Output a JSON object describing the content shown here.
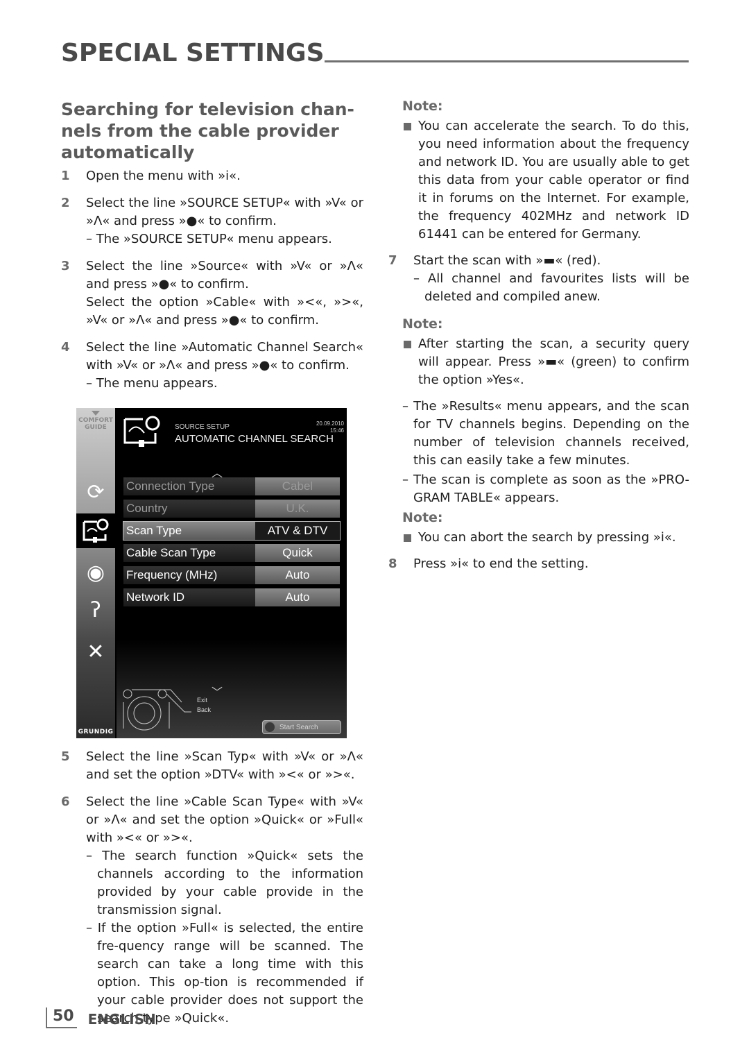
{
  "header": {
    "title": "SPECIAL SETTINGS"
  },
  "section": {
    "title": "Searching for television chan-nels from the cable provider automatically"
  },
  "keys": {
    "info": "i",
    "down": "V",
    "up": "Λ",
    "ok": "●",
    "left": "<",
    "right": ">"
  },
  "steps": [
    {
      "num": "1",
      "lines": [
        "Open the menu with »i«."
      ]
    },
    {
      "num": "2",
      "lines": [
        "Select the line »SOURCE SETUP« with »V« or »Λ« and press »●« to confirm."
      ],
      "subs": [
        "– The »SOURCE SETUP« menu appears."
      ]
    },
    {
      "num": "3",
      "lines": [
        "Select the line »Source« with »V« or »Λ« and press »●« to confirm.",
        "Select the option »Cable« with »<«, »>«, »V« or »Λ« and press »●« to confirm."
      ]
    },
    {
      "num": "4",
      "lines": [
        "Select the line »Automatic Channel Search« with »V« or »Λ« and press »●« to confirm."
      ],
      "subs": [
        "– The menu appears."
      ]
    },
    {
      "num": "5",
      "lines": [
        "Select the line »Scan Typ« with »V« or »Λ« and set the option »DTV« with »<« or »>«."
      ]
    },
    {
      "num": "6",
      "lines": [
        "Select the line »Cable Scan Type« with »V« or »Λ« and set the option »Quick« or »Full« with »<« or »>«."
      ],
      "subs": [
        "– The search function »Quick« sets the channels according to the information provided by your cable provide in the transmission signal.",
        "– If the option »Full« is selected, the entire fre-quency range will be scanned. The search can take a long time with this option. This op-tion is recommended if your cable provider does not support the search type »Quick«."
      ]
    },
    {
      "num": "7",
      "lines": [
        "Start the scan with »▬« (red)."
      ],
      "subs": [
        "– All channel and favourites lists will be deleted and compiled anew."
      ]
    },
    {
      "num": "8",
      "lines": [
        "Press »i« to end the setting."
      ]
    }
  ],
  "notes": [
    {
      "title": "Note:",
      "text": "You can accelerate the search. To do this, you need information about the frequency and network ID. You are usually able to get this data from your cable operator or find it in forums on the Internet. For example, the frequency 402MHz and network ID 61441 can be entered for Germany."
    },
    {
      "title": "Note:",
      "text": "After starting the scan, a security query will appear. Press »▬« (green) to confirm the option »Yes«.",
      "subs": [
        "– The »Results« menu appears, and the scan for TV channels begins. Depending on the number of television channels received, this can easily take a few minutes.",
        "– The scan is complete as soon as the »PRO-GRAM TABLE« appears."
      ]
    },
    {
      "title": "Note:",
      "text": "You can abort the search by pressing »i«."
    }
  ],
  "tv_menu": {
    "sidebar_guide": "COMFORT GUIDE",
    "brand": "GRUNDIG",
    "breadcrumb": "SOURCE SETUP",
    "title": "AUTOMATIC CHANNEL SEARCH",
    "date": "20.09.2010",
    "time": "15:46",
    "rows": [
      {
        "label": "Connection Type",
        "value": "Cabel",
        "state": "dim"
      },
      {
        "label": "Country",
        "value": "U.K.",
        "state": "dim"
      },
      {
        "label": "Scan Type",
        "value": "ATV & DTV",
        "state": "selected"
      },
      {
        "label": "Cable Scan Type",
        "value": "Quick",
        "state": "normal"
      },
      {
        "label": "Frequency (MHz)",
        "value": "Auto",
        "state": "normal"
      },
      {
        "label": "Network ID",
        "value": "Auto",
        "state": "normal"
      }
    ],
    "legend_exit": "Exit",
    "legend_back": "Back",
    "start_search": "Start Search"
  },
  "footer": {
    "page": "50",
    "language": "ENGLISH"
  }
}
